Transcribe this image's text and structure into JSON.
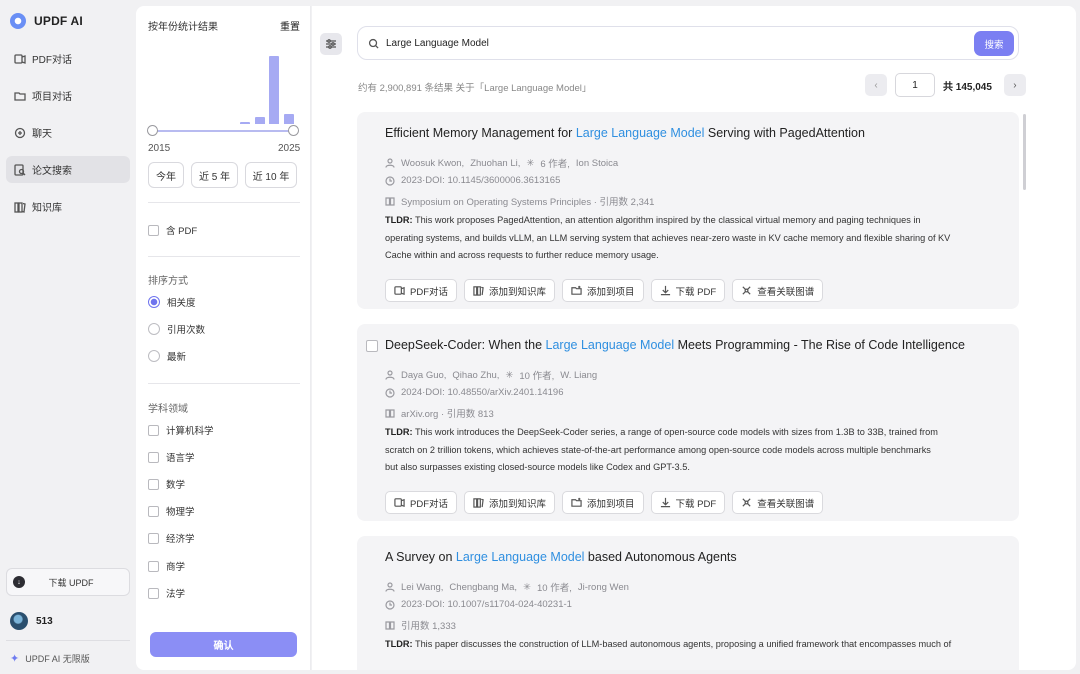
{
  "app": {
    "name": "UPDF AI"
  },
  "nav": {
    "items": [
      {
        "label": "PDF对话",
        "icon": "pdf-chat-icon"
      },
      {
        "label": "项目对话",
        "icon": "folder-icon"
      },
      {
        "label": "聊天",
        "icon": "chat-icon"
      },
      {
        "label": "论文搜索",
        "icon": "paper-search-icon",
        "active": true
      },
      {
        "label": "知识库",
        "icon": "library-icon"
      }
    ],
    "download_label": "下载 UPDF",
    "user_count": "513",
    "plan_label": "UPDF AI 无限版"
  },
  "filter": {
    "year_title": "按年份统计结果",
    "reset_label": "重置",
    "histogram": [
      0,
      0,
      0,
      0,
      0,
      0,
      0.03,
      0.1,
      1.0,
      0.15
    ],
    "year_min": "2015",
    "year_max": "2025",
    "chips": [
      "今年",
      "近 5 年",
      "近 10 年"
    ],
    "pdf_label": "含 PDF",
    "sort_title": "排序方式",
    "sort_options": [
      "相关度",
      "引用次数",
      "最新"
    ],
    "field_title": "学科领域",
    "fields": [
      "计算机科学",
      "语言学",
      "数学",
      "物理学",
      "经济学",
      "商学",
      "法学"
    ],
    "confirm_label": "确认"
  },
  "search": {
    "query": "Large Language Model",
    "button_label": "搜索",
    "result_count_text": "约有 2,900,891 条结果 关于「Large Language Model」",
    "page": "1",
    "total_pages_text": "共 145,045"
  },
  "actions": [
    "PDF对话",
    "添加到知识库",
    "添加到项目",
    "下载 PDF",
    "查看关联图谱"
  ],
  "results": [
    {
      "title_pre": "Efficient Memory Management for ",
      "title_hl": "Large Language Model",
      "title_post": " Serving with PagedAttention",
      "authors": [
        "Woosuk Kwon,",
        "Zhuohan Li,",
        "6 作者,",
        "Ion Stoica"
      ],
      "doi": "2023·DOI: 10.1145/3600006.3613165",
      "venue": "Symposium on Operating Systems Principles · 引用数 2,341",
      "tldr_label": "TLDR:",
      "tldr_lines": [
        "This work proposes PagedAttention, an attention algorithm inspired by the classical virtual memory and paging techniques in",
        "operating systems, and builds vLLM, an LLM serving system that achieves near-zero waste in KV cache memory and flexible sharing of KV",
        "Cache within and across requests to further reduce memory usage."
      ]
    },
    {
      "title_pre": "DeepSeek-Coder: When the ",
      "title_hl": "Large Language Model",
      "title_post": " Meets Programming - The Rise of Code Intelligence",
      "authors": [
        "Daya Guo,",
        "Qihao Zhu,",
        "10 作者,",
        "W. Liang"
      ],
      "doi": "2024·DOI: 10.48550/arXiv.2401.14196",
      "venue": "arXiv.org · 引用数 813",
      "tldr_label": "TLDR:",
      "tldr_lines": [
        "This work introduces the DeepSeek-Coder series, a range of open-source code models with sizes from 1.3B to 33B, trained from",
        "scratch on 2 trillion tokens, which achieves state-of-the-art performance among open-source code models across multiple benchmarks",
        "but also surpasses existing closed-source models like Codex and GPT-3.5."
      ]
    },
    {
      "title_pre": "A Survey on ",
      "title_hl": "Large Language Model",
      "title_post": " based Autonomous Agents",
      "authors": [
        "Lei Wang,",
        "Chengbang Ma,",
        "10 作者,",
        "Ji-rong Wen"
      ],
      "doi": "2023·DOI: 10.1007/s11704-024-40231-1",
      "venue": "引用数 1,333",
      "tldr_label": "TLDR:",
      "tldr_lines": [
        "This paper discusses the construction of LLM-based autonomous agents, proposing a unified framework that encompasses much of"
      ]
    }
  ]
}
